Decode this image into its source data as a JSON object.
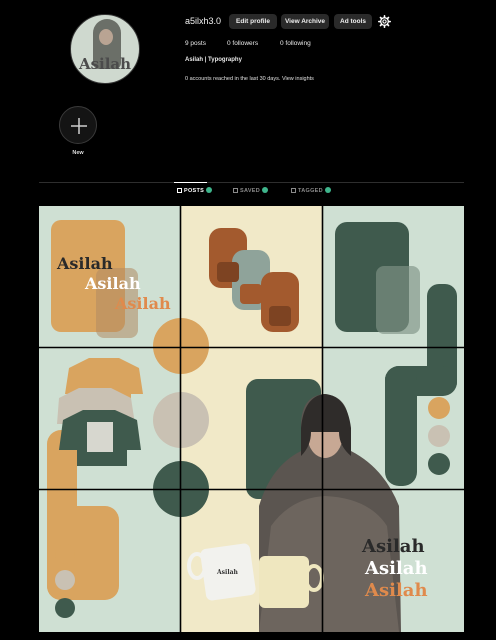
{
  "profile": {
    "username": "a5ilxh3.0",
    "avatar_text": "Asilah",
    "edit_profile_label": "Edit profile",
    "view_archive_label": "View Archive",
    "ad_tools_label": "Ad tools",
    "settings_icon": "gear-icon",
    "stats": {
      "posts": "9 posts",
      "followers": "0 followers",
      "following": "0 following"
    },
    "bio_name": "Asilah | Typography",
    "insight_text": "0 accounts reached in the last 30 days.",
    "insight_link": "View insights"
  },
  "highlights": {
    "new_label": "New"
  },
  "tabs": [
    {
      "label": "POSTS",
      "active": true
    },
    {
      "label": "SAVED",
      "active": false
    },
    {
      "label": "TAGGED",
      "active": false
    }
  ],
  "grid": {
    "brand_words": [
      "Asilah",
      "Asilah",
      "Asilah"
    ],
    "bottom_words": [
      "Asilah",
      "Asilah",
      "Asilah"
    ],
    "mug_label": "Asilah",
    "colors": {
      "background": "#cfe0d3",
      "dark_green": "#3f5a4d",
      "tan": "#d9a45f",
      "beige": "#c9c1b3",
      "cream": "#f1e9c8",
      "orange": "#e08a4c"
    }
  }
}
